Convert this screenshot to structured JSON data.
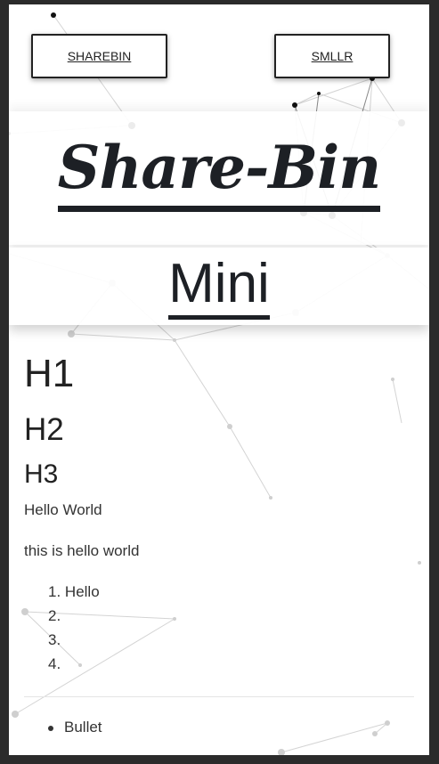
{
  "nav": {
    "left_label": "SHAREBIN",
    "right_label": "SMLLR"
  },
  "header": {
    "title": "Share-Bin",
    "subtitle": "Mini"
  },
  "content": {
    "h1": "H1",
    "h2": "H2",
    "h3": "H3",
    "p1": "Hello World",
    "p2": "this is hello world",
    "ordered_list": [
      "1.",
      "2.",
      "3.",
      "4."
    ],
    "ordered_list_text": [
      "Hello",
      "",
      "",
      ""
    ],
    "bullets": [
      "Bullet"
    ]
  },
  "colors": {
    "frame_bg": "#2b2b2b",
    "text": "#1d2025",
    "border": "#222222"
  }
}
